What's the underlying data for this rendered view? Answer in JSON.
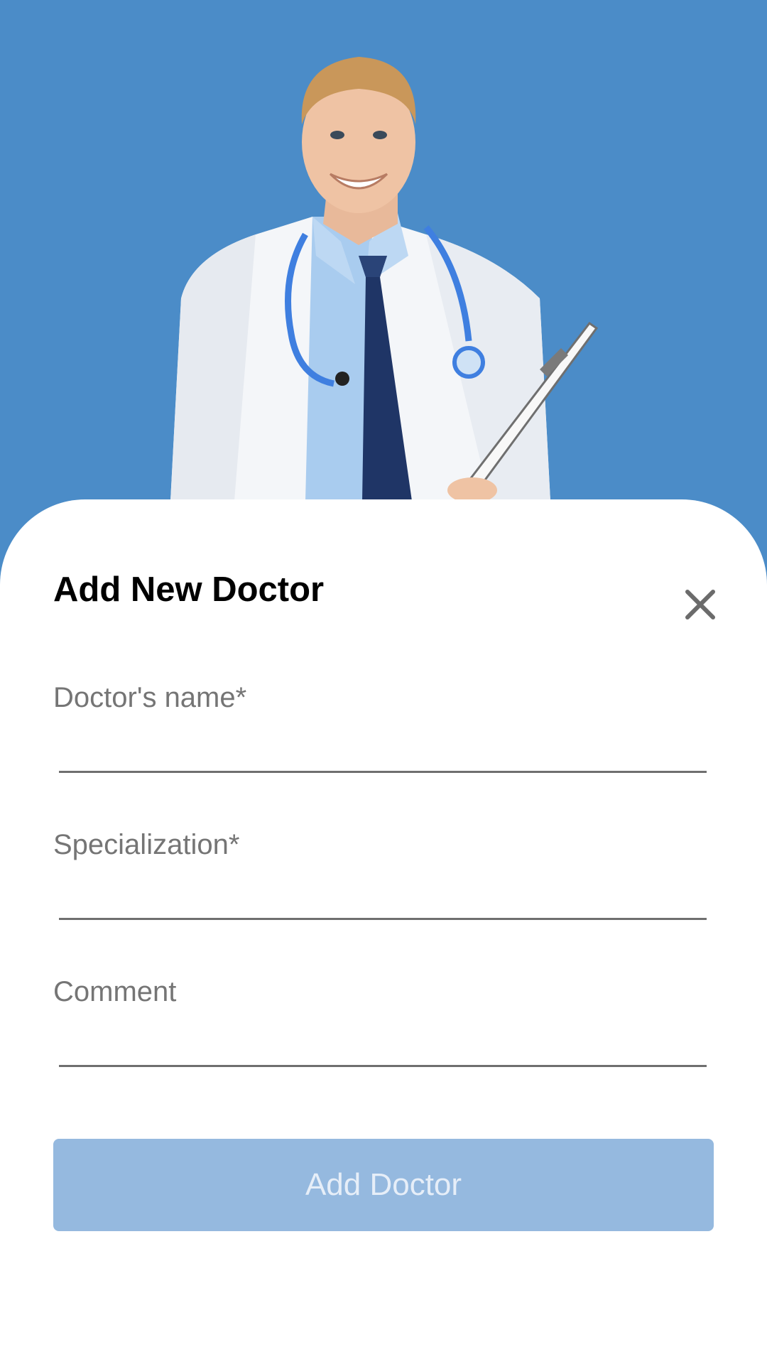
{
  "colors": {
    "background": "#4b8cc8",
    "sheet": "#ffffff",
    "button_disabled": "#95b9df",
    "button_text": "#e6eef8",
    "label": "#757575",
    "underline": "#6f6f6f"
  },
  "hero": {
    "image": "doctor-illustration"
  },
  "dialog": {
    "title": "Add New Doctor",
    "close_icon": "close-icon",
    "fields": [
      {
        "label": "Doctor's name*",
        "value": ""
      },
      {
        "label": "Specialization*",
        "value": ""
      },
      {
        "label": "Comment",
        "value": ""
      }
    ],
    "submit_label": "Add Doctor"
  }
}
